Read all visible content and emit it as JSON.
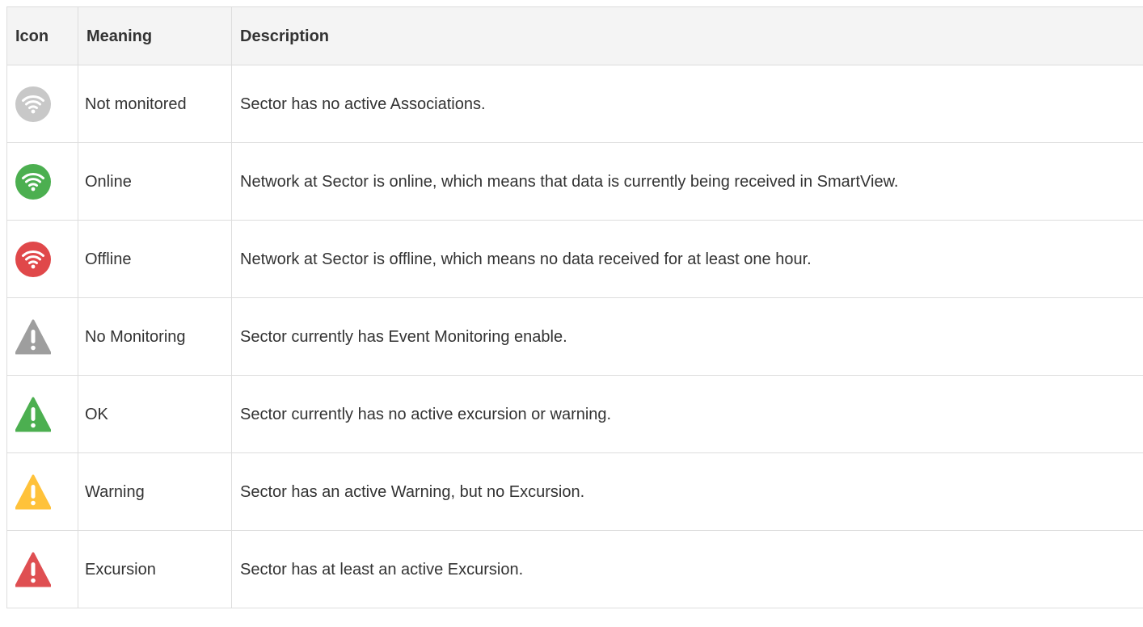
{
  "table": {
    "headers": {
      "icon": "Icon",
      "meaning": "Meaning",
      "description": "Description"
    },
    "rows": [
      {
        "icon": "wifi-circle-gray-icon",
        "icon_color": "#c8c8c8",
        "meaning": "Not monitored",
        "description": "Sector has no active Associations."
      },
      {
        "icon": "wifi-circle-green-icon",
        "icon_color": "#4caf50",
        "meaning": "Online",
        "description": "Network at Sector is online, which means that data is currently being received in SmartView."
      },
      {
        "icon": "wifi-circle-red-icon",
        "icon_color": "#e0484a",
        "meaning": "Offline",
        "description": "Network at Sector is offline, which means no data received for at least one hour."
      },
      {
        "icon": "warning-triangle-gray-icon",
        "icon_color": "#9e9e9e",
        "meaning": "No Monitoring",
        "description": "Sector currently has Event Monitoring enable."
      },
      {
        "icon": "warning-triangle-green-icon",
        "icon_color": "#4caf50",
        "meaning": "OK",
        "description": "Sector currently has no active excursion or warning."
      },
      {
        "icon": "warning-triangle-yellow-icon",
        "icon_color": "#ffc23a",
        "meaning": "Warning",
        "description": "Sector has an active Warning, but no Excursion."
      },
      {
        "icon": "warning-triangle-red-icon",
        "icon_color": "#df4f52",
        "meaning": "Excursion",
        "description": "Sector has at least an active Excursion."
      }
    ]
  }
}
